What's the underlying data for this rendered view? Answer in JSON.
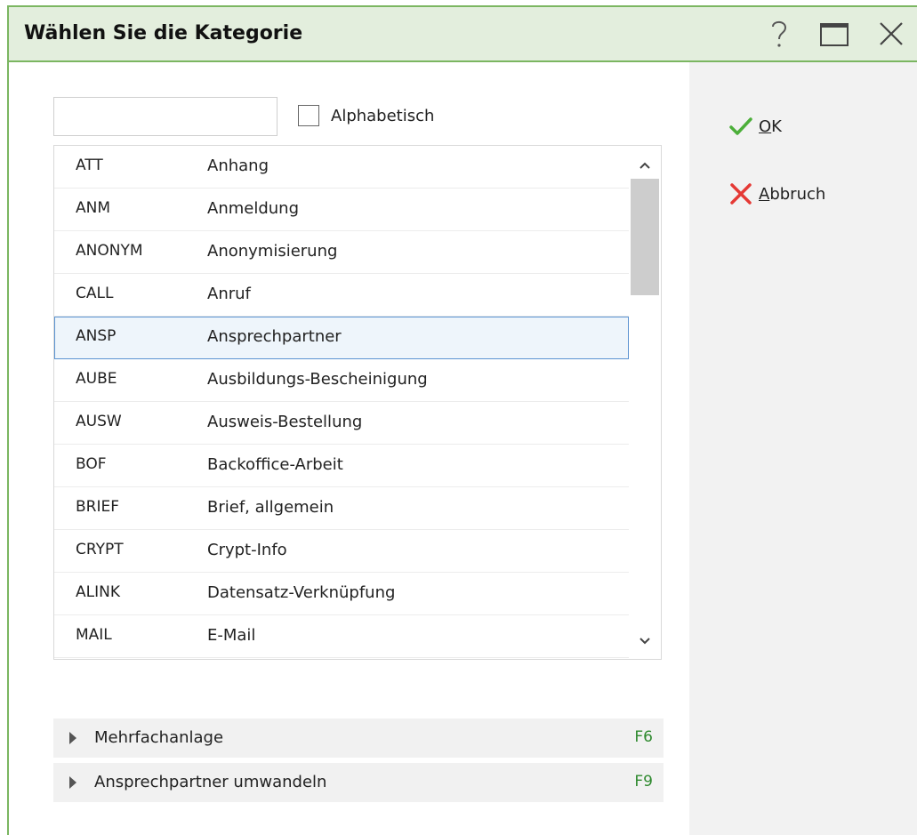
{
  "window": {
    "title": "Wählen Sie die Kategorie",
    "buttons": [
      "help-icon",
      "maximize-icon",
      "close-icon"
    ]
  },
  "search": {
    "value": "",
    "placeholder": ""
  },
  "alphabetical": {
    "label": "Alphabetisch",
    "checked": false
  },
  "list": {
    "rows": [
      {
        "code": "ATT",
        "name": "Anhang"
      },
      {
        "code": "ANM",
        "name": "Anmeldung"
      },
      {
        "code": "ANONYM",
        "name": "Anonymisierung"
      },
      {
        "code": "CALL",
        "name": "Anruf"
      },
      {
        "code": "ANSP",
        "name": "Ansprechpartner"
      },
      {
        "code": "AUBE",
        "name": "Ausbildungs-Bescheinigung"
      },
      {
        "code": "AUSW",
        "name": "Ausweis-Bestellung"
      },
      {
        "code": "BOF",
        "name": "Backoffice-Arbeit"
      },
      {
        "code": "BRIEF",
        "name": "Brief, allgemein"
      },
      {
        "code": "CRYPT",
        "name": "Crypt-Info"
      },
      {
        "code": "ALINK",
        "name": "Datensatz-Verknüpfung"
      },
      {
        "code": "MAIL",
        "name": "E-Mail"
      }
    ],
    "selected_index": 4
  },
  "actions": {
    "ok": {
      "mnemonic": "O",
      "rest": "K"
    },
    "cancel": {
      "mnemonic": "A",
      "rest": "bbruch"
    }
  },
  "function_bars": [
    {
      "label": "Mehrfachanlage",
      "key": "F6"
    },
    {
      "label": "Ansprechpartner umwandeln",
      "key": "F9"
    }
  ],
  "colors": {
    "accent_green": "#7bb661",
    "title_bg": "#e3eedd",
    "selection_border": "#5b93d1",
    "ok_check": "#4caf3a",
    "cancel_x": "#e53935",
    "fkey": "#2f8a2f"
  }
}
